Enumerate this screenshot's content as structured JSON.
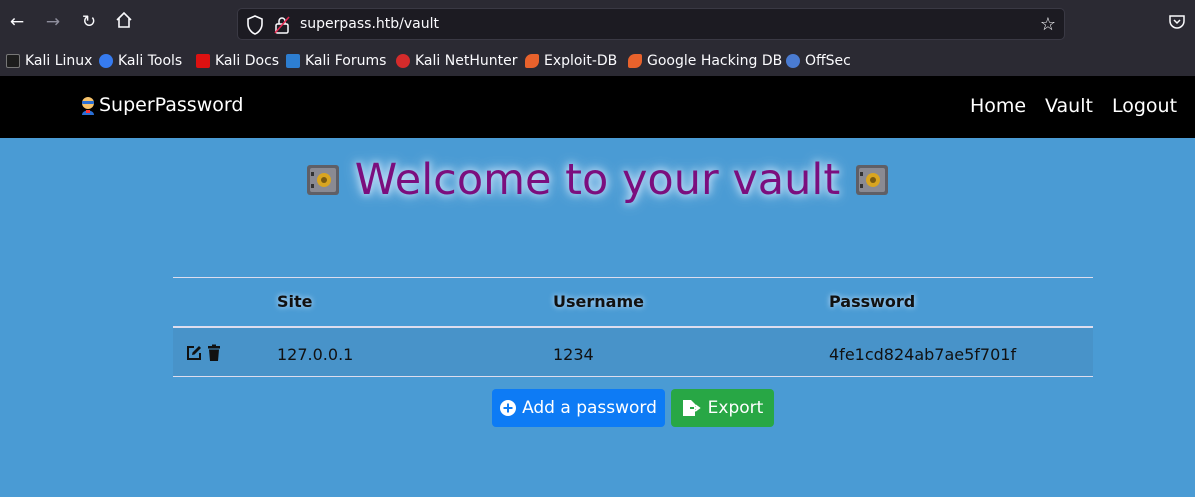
{
  "browser": {
    "url": "superpass.htb/vault",
    "bookmarks": [
      {
        "label": "Kali Linux",
        "icon": "kali-dragon-icon"
      },
      {
        "label": "Kali Tools",
        "icon": "kali-tools-icon"
      },
      {
        "label": "Kali Docs",
        "icon": "kali-docs-icon"
      },
      {
        "label": "Kali Forums",
        "icon": "kali-forums-icon"
      },
      {
        "label": "Kali NetHunter",
        "icon": "nethunter-icon"
      },
      {
        "label": "Exploit-DB",
        "icon": "exploit-db-icon"
      },
      {
        "label": "Google Hacking DB",
        "icon": "ghdb-icon"
      },
      {
        "label": "OffSec",
        "icon": "offsec-icon"
      }
    ]
  },
  "site": {
    "brand": "SuperPassword",
    "nav": {
      "home": "Home",
      "vault": "Vault",
      "logout": "Logout"
    }
  },
  "vault": {
    "title": "Welcome to your vault",
    "columns": [
      "Site",
      "Username",
      "Password"
    ],
    "rows": [
      {
        "site": "127.0.0.1",
        "username": "1234",
        "password": "4fe1cd824ab7ae5f701f"
      }
    ],
    "add_label": "Add a password",
    "export_label": "Export"
  },
  "colors": {
    "page_bg": "#4a9bd4",
    "title": "#7b0e7e",
    "add_button": "#0d7bf5",
    "export_button": "#28a745"
  }
}
